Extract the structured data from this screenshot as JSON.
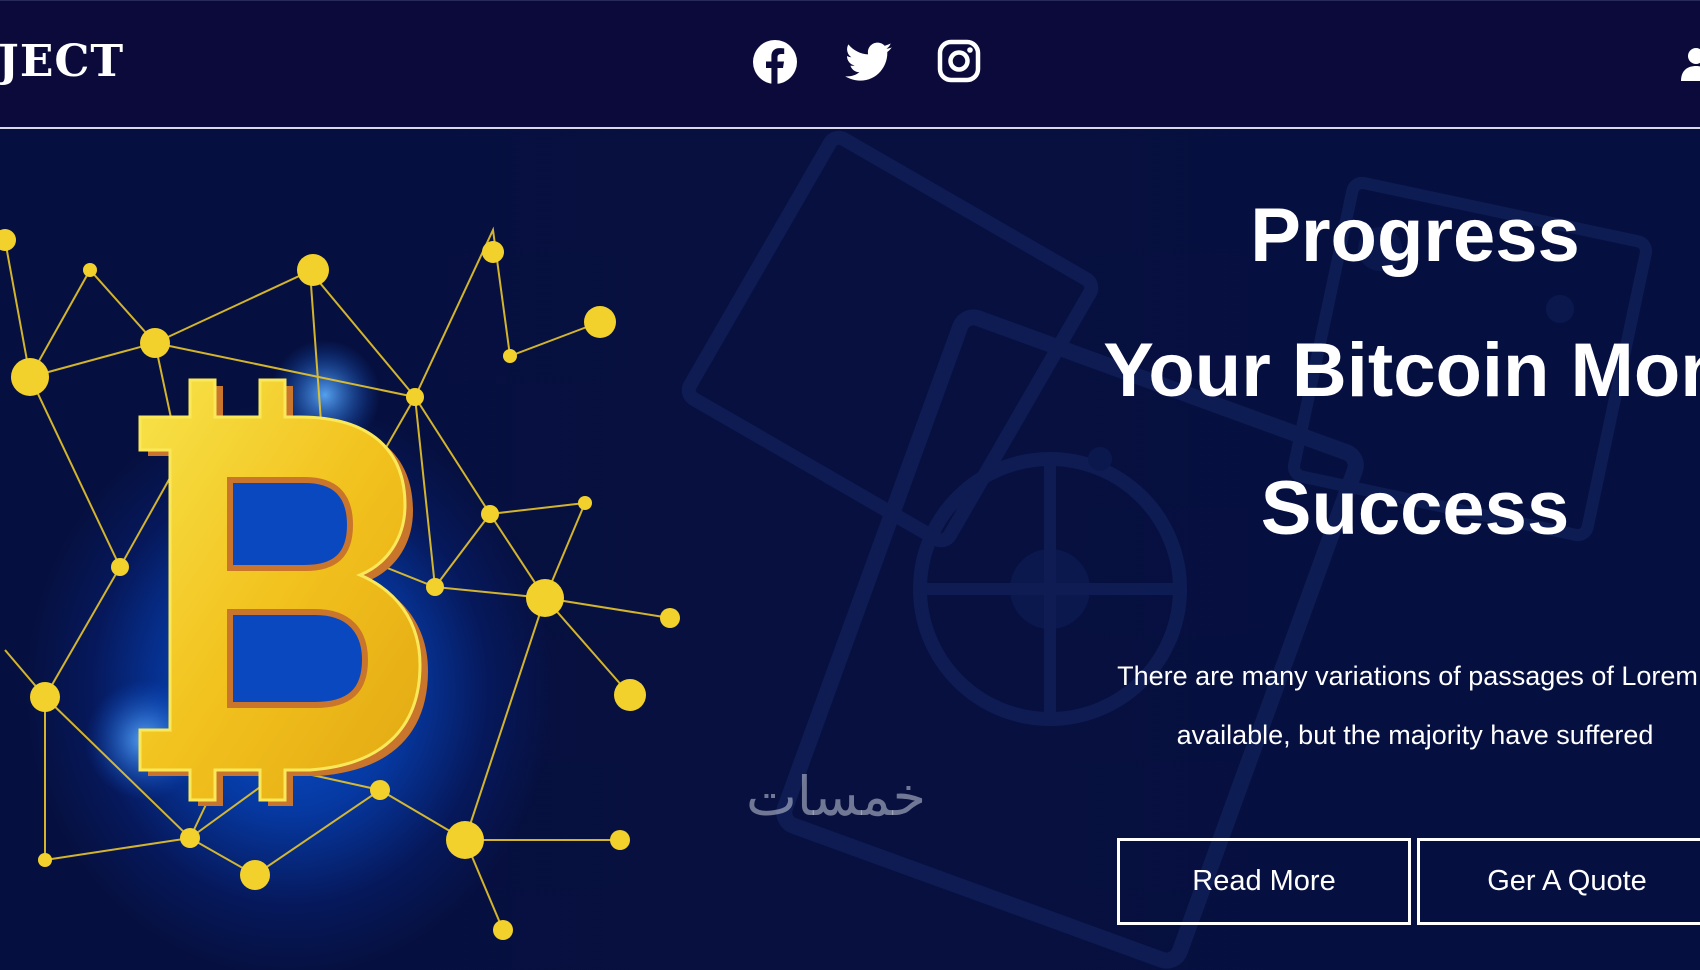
{
  "header": {
    "logo_text": "JECT",
    "social": [
      {
        "name": "facebook-icon"
      },
      {
        "name": "twitter-icon"
      },
      {
        "name": "instagram-icon"
      }
    ]
  },
  "hero": {
    "title_lines": [
      "Progress",
      "Your Bitcoin Mon",
      "Success"
    ],
    "description_lines": [
      "There are many variations of passages of Lorem I",
      "available, but the majority have suffered"
    ],
    "buttons": {
      "read_more": "Read More",
      "get_quote": "Ger A Quote"
    },
    "watermark": "خمسات"
  },
  "colors": {
    "header_bg": "#0b0a3a",
    "hero_bg": "#061040",
    "accent_gold": "#f2d12c",
    "glow_blue": "#0b55d8"
  }
}
